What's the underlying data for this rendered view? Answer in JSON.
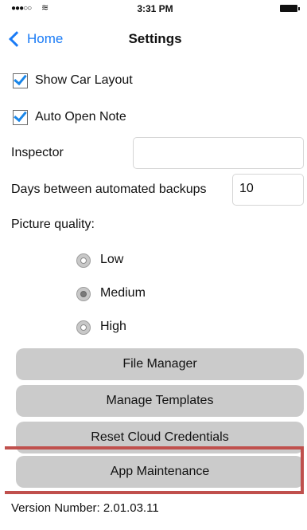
{
  "status_bar": {
    "signal": "●●●○○",
    "wifi": "≋",
    "time": "3:31 PM"
  },
  "nav": {
    "back_label": "Home",
    "title": "Settings"
  },
  "settings": {
    "show_car_layout": {
      "label": "Show Car Layout",
      "checked": true
    },
    "auto_open_note": {
      "label": "Auto Open Note",
      "checked": true
    },
    "inspector": {
      "label": "Inspector",
      "value": ""
    },
    "backup_days": {
      "label": "Days between automated backups",
      "value": "10"
    },
    "picture_quality": {
      "label": "Picture quality:",
      "options": [
        "Low",
        "Medium",
        "High"
      ],
      "selected": "Medium"
    }
  },
  "buttons": {
    "file_manager": "File Manager",
    "manage_templates": "Manage Templates",
    "reset_cloud_credentials": "Reset Cloud Credentials",
    "app_maintenance": "App Maintenance"
  },
  "version": "Version Number: 2.01.03.11",
  "colors": {
    "accent": "#1a7bf6",
    "button_bg": "#cbcbcb",
    "highlight_border": "#c0504d"
  }
}
